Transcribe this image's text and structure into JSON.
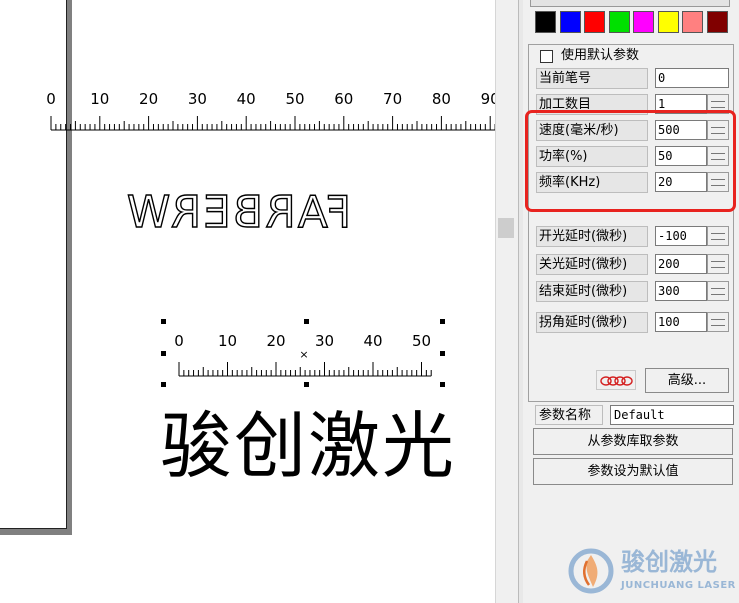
{
  "canvas": {
    "ruler_top": {
      "labels": [
        "0",
        "10",
        "20",
        "30",
        "40",
        "50",
        "60",
        "70",
        "80",
        "90"
      ]
    },
    "mirrored_text": "FARBERW",
    "ruler_object": {
      "labels": [
        "0",
        "10",
        "20",
        "30",
        "40",
        "50"
      ]
    },
    "chinese_text": "骏创激光"
  },
  "panel": {
    "colors": [
      "#000000",
      "#0000ff",
      "#ff0000",
      "#00e000",
      "#ff00ff",
      "#ffff00",
      "#ff8080",
      "#800000"
    ],
    "use_default_label": "使用默认参数",
    "rows": [
      {
        "label": "当前笔号",
        "value": "0",
        "spin": false
      },
      {
        "label": "加工数目",
        "value": "1",
        "spin": true
      },
      {
        "label": "速度(毫米/秒)",
        "value": "500",
        "spin": true
      },
      {
        "label": "功率(%)",
        "value": "50",
        "spin": true
      },
      {
        "label": "频率(KHz)",
        "value": "20",
        "spin": true
      },
      {
        "label": "开光延时(微秒)",
        "value": "-100",
        "spin": true
      },
      {
        "label": "关光延时(微秒)",
        "value": "200",
        "spin": true
      },
      {
        "label": "结束延时(微秒)",
        "value": "300",
        "spin": true
      },
      {
        "label": "拐角延时(微秒)",
        "value": "100",
        "spin": true
      }
    ],
    "advanced_button": "高级...",
    "param_name_label": "参数名称",
    "param_name_value": "Default",
    "load_from_lib_button": "从参数库取参数",
    "set_default_button": "参数设为默认值"
  },
  "watermark": {
    "brand_cn": "骏创激光",
    "brand_en": "JUNCHUANG LASER"
  }
}
